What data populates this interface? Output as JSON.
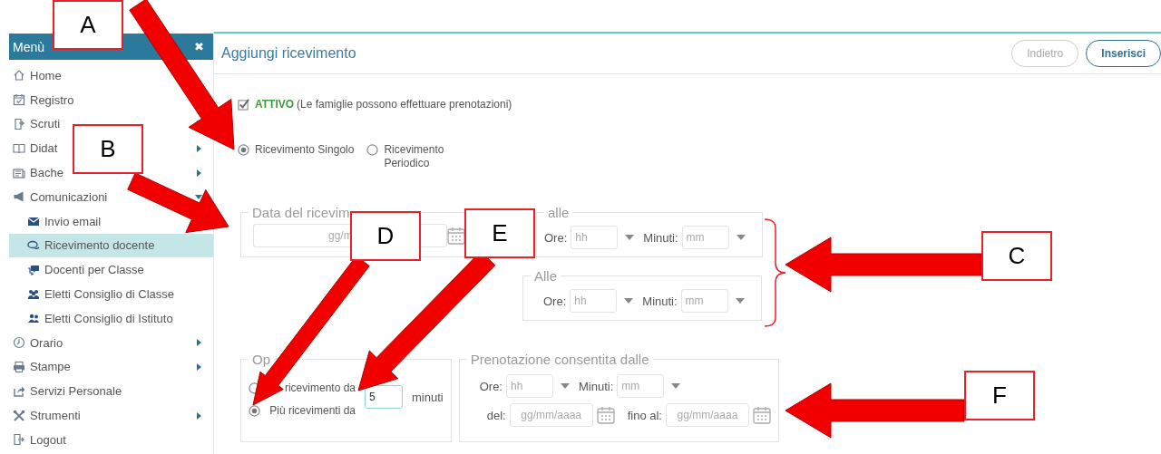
{
  "sidebar": {
    "title": "Menù",
    "close": "✖",
    "items": [
      {
        "label": "Home",
        "selected": false
      },
      {
        "label": "Registro",
        "selected": false
      },
      {
        "label": "Scruti",
        "selected": false,
        "expanded": false
      },
      {
        "label": "Didat",
        "selected": false,
        "expanded": false
      },
      {
        "label": "Bache",
        "selected": false,
        "expanded": false
      },
      {
        "label": "Comunicazioni",
        "selected": false,
        "expanded": true,
        "children": [
          {
            "label": "Invio email",
            "selected": false
          },
          {
            "label": "Ricevimento docente",
            "selected": true
          },
          {
            "label": "Docenti per Classe",
            "selected": false
          },
          {
            "label": "Eletti Consiglio di Classe",
            "selected": false
          },
          {
            "label": "Eletti Consiglio di Istituto",
            "selected": false
          }
        ]
      },
      {
        "label": "Orario",
        "selected": false,
        "expanded": false
      },
      {
        "label": "Stampe",
        "selected": false,
        "expanded": false
      },
      {
        "label": "Servizi Personale",
        "selected": false
      },
      {
        "label": "Strumenti",
        "selected": false,
        "expanded": false
      },
      {
        "label": "Logout",
        "selected": false
      }
    ]
  },
  "header": {
    "title": "Aggiungi ricevimento",
    "buttons": [
      {
        "label": "Indietro",
        "disabled": true
      },
      {
        "label": "Inserisci",
        "disabled": false
      }
    ]
  },
  "active": {
    "checked": true,
    "label": "ATTIVO",
    "note": "(Le famiglie possono effettuare prenotazioni)"
  },
  "type_options": [
    {
      "label": "Ricevimento Singolo",
      "selected": true
    },
    {
      "label": "Ricevimento Periodico",
      "selected": false
    }
  ],
  "date_group": {
    "legend": "Data del ricevim",
    "placeholder": "gg/m"
  },
  "from_group": {
    "legend": "alle",
    "hours_label": "Ore:",
    "hours_placeholder": "hh",
    "minutes_label": "Minuti:",
    "minutes_placeholder": "mm"
  },
  "to_group": {
    "legend": "Alle",
    "hours_label": "Ore:",
    "hours_placeholder": "hh",
    "minutes_label": "Minuti:",
    "minutes_placeholder": "mm"
  },
  "options_group": {
    "legend": "Op",
    "choices": [
      {
        "label": "ricevimento da",
        "selected": false
      },
      {
        "label": "Più ricevimenti da",
        "selected": true
      }
    ],
    "interval_value": "5",
    "interval_unit": "minuti"
  },
  "booking_group": {
    "legend": "Prenotazione consentita dalle",
    "hours_label": "Ore:",
    "hours_placeholder": "hh",
    "minutes_label": "Minuti:",
    "minutes_placeholder": "mm",
    "from_label": "del:",
    "from_placeholder": "gg/mm/aaaa",
    "to_label": "fino al:",
    "to_placeholder": "gg/mm/aaaa"
  },
  "annotations": [
    {
      "label": "A"
    },
    {
      "label": "B"
    },
    {
      "label": "C"
    },
    {
      "label": "D"
    },
    {
      "label": "E"
    },
    {
      "label": "F"
    }
  ]
}
